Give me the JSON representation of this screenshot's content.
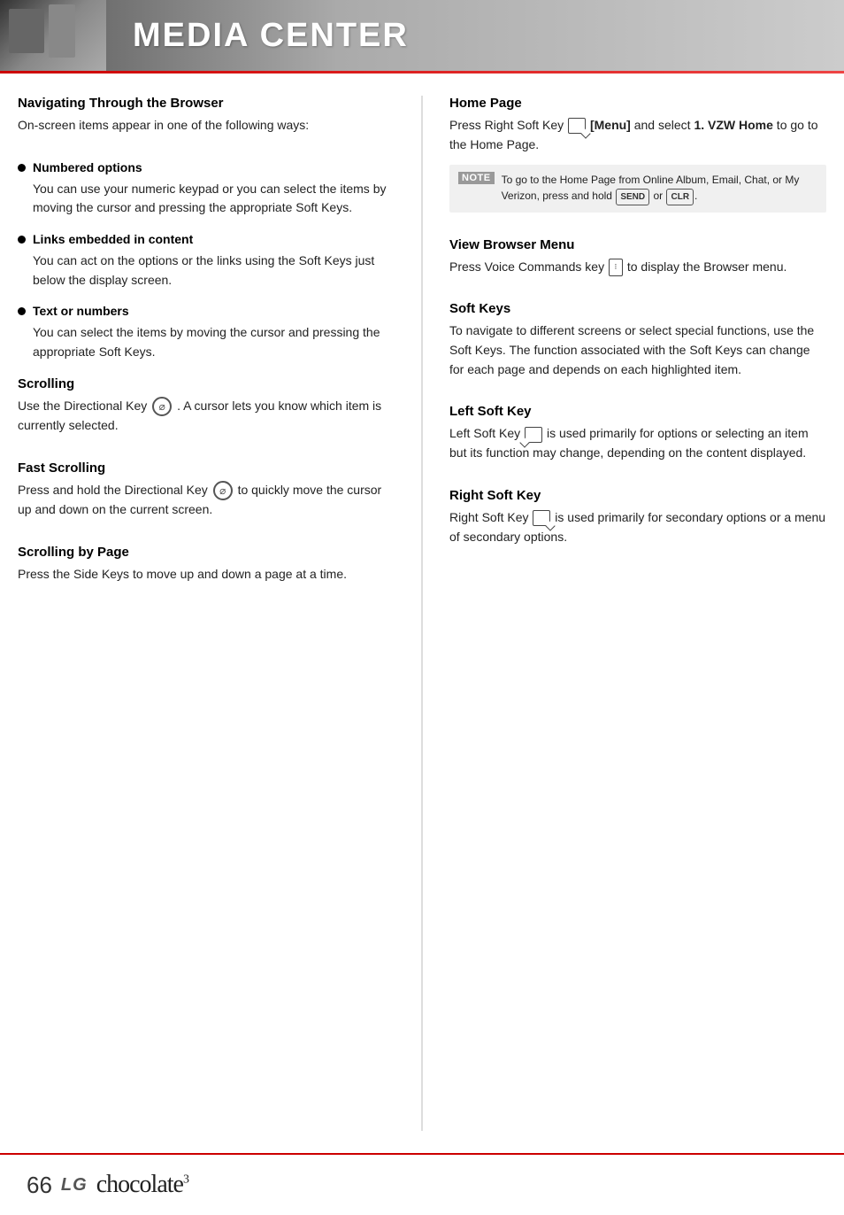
{
  "header": {
    "title": "MEDIA CENTER"
  },
  "left_col": {
    "navigating": {
      "title": "Navigating Through the Browser",
      "body": "On-screen items appear in one of the following ways:"
    },
    "bullets": [
      {
        "title": "Numbered options",
        "body": "You can use your numeric keypad or you can select the items by moving the cursor and pressing the appropriate Soft Keys."
      },
      {
        "title": "Links embedded in content",
        "body": "You can act on the options or the links using the Soft Keys just below the display screen."
      },
      {
        "title": "Text or numbers",
        "body": "You can select the items by moving the cursor and pressing the appropriate Soft Keys."
      }
    ],
    "scrolling": {
      "title": "Scrolling",
      "body1": "Use the Directional Key",
      "body2": ". A cursor lets you know which item is currently selected."
    },
    "fast_scrolling": {
      "title": "Fast Scrolling",
      "body1": "Press and hold the Directional Key",
      "body2": "to quickly move the cursor up and down on the current screen."
    },
    "scrolling_by_page": {
      "title": "Scrolling by Page",
      "body": "Press the Side Keys to move up and down a page at a time."
    }
  },
  "right_col": {
    "home_page": {
      "title": "Home Page",
      "body1": "Press Right Soft Key",
      "menu_label": "[Menu]",
      "body2": "and select",
      "vzw_label": "1. VZW Home",
      "body3": "to go to the Home Page."
    },
    "note": {
      "label": "NOTE",
      "text": "To go to the Home Page from Online Album, Email, Chat, or My Verizon, press and hold",
      "send_label": "SEND",
      "or_text": "or",
      "clr_label": "CLR"
    },
    "view_browser_menu": {
      "title": "View Browser Menu",
      "body1": "Press Voice Commands key",
      "body2": "to display the Browser menu."
    },
    "soft_keys": {
      "title": "Soft Keys",
      "body": "To navigate to different screens or select special functions, use the Soft Keys. The function associated with the Soft Keys can change for each page and depends on each highlighted item."
    },
    "left_soft_key": {
      "title": "Left Soft Key",
      "body1": "Left Soft Key",
      "body2": "is used primarily for options or selecting an item but its function may change, depending on the content displayed."
    },
    "right_soft_key": {
      "title": "Right Soft Key",
      "body1": "Right Soft Key",
      "body2": "is used primarily for secondary options or a menu of secondary options."
    }
  },
  "footer": {
    "page_number": "66",
    "logo_lg": "LG",
    "logo_brand": "chocolate",
    "logo_sup": "3"
  }
}
